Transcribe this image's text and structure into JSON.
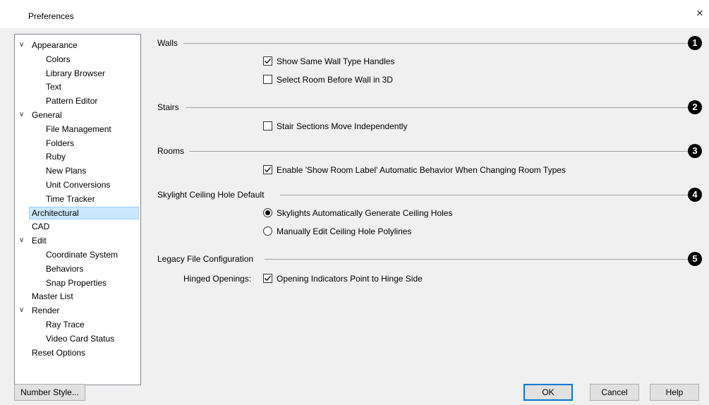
{
  "window": {
    "title": "Preferences"
  },
  "tree": {
    "items": [
      {
        "label": "Appearance",
        "level": 0,
        "expanded": true
      },
      {
        "label": "Colors",
        "level": 1
      },
      {
        "label": "Library Browser",
        "level": 1
      },
      {
        "label": "Text",
        "level": 1
      },
      {
        "label": "Pattern Editor",
        "level": 1
      },
      {
        "label": "General",
        "level": 0,
        "expanded": true
      },
      {
        "label": "File Management",
        "level": 1
      },
      {
        "label": "Folders",
        "level": 1
      },
      {
        "label": "Ruby",
        "level": 1
      },
      {
        "label": "New Plans",
        "level": 1
      },
      {
        "label": "Unit Conversions",
        "level": 1
      },
      {
        "label": "Time Tracker",
        "level": 1
      },
      {
        "label": "Architectural",
        "level": 0,
        "selected": true
      },
      {
        "label": "CAD",
        "level": 0
      },
      {
        "label": "Edit",
        "level": 0,
        "expanded": true
      },
      {
        "label": "Coordinate System",
        "level": 1
      },
      {
        "label": "Behaviors",
        "level": 1
      },
      {
        "label": "Snap Properties",
        "level": 1
      },
      {
        "label": "Master List",
        "level": 0
      },
      {
        "label": "Render",
        "level": 0,
        "expanded": true
      },
      {
        "label": "Ray Trace",
        "level": 1
      },
      {
        "label": "Video Card Status",
        "level": 1
      },
      {
        "label": "Reset Options",
        "level": 0
      }
    ]
  },
  "sections": {
    "walls": {
      "title": "Walls",
      "callout": "1",
      "show_same_wall_type_handles": {
        "label": "Show Same Wall Type Handles",
        "checked": true
      },
      "select_room_before_wall": {
        "label": "Select Room Before Wall in 3D",
        "checked": false
      }
    },
    "stairs": {
      "title": "Stairs",
      "callout": "2",
      "stair_sections_move": {
        "label": "Stair Sections Move Independently",
        "checked": false
      }
    },
    "rooms": {
      "title": "Rooms",
      "callout": "3",
      "enable_show_room_label": {
        "label": "Enable 'Show Room Label' Automatic Behavior When Changing Room Types",
        "checked": true
      }
    },
    "skylight": {
      "title": "Skylight Ceiling Hole Default",
      "callout": "4",
      "auto_generate": {
        "label": "Skylights Automatically Generate Ceiling Holes",
        "selected": true
      },
      "manual_edit": {
        "label": "Manually Edit Ceiling Hole Polylines",
        "selected": false
      }
    },
    "legacy": {
      "title": "Legacy File Configuration",
      "callout": "5",
      "hinged_openings_label": "Hinged Openings:",
      "opening_indicators": {
        "label": "Opening Indicators Point to Hinge Side",
        "checked": true
      }
    }
  },
  "buttons": {
    "number_style": "Number Style...",
    "ok": "OK",
    "cancel": "Cancel",
    "help": "Help"
  },
  "icons": {
    "close": "×",
    "chevron": "∨"
  },
  "colors": {
    "selection_bg": "#cce8ff",
    "default_button_border": "#0078d7"
  }
}
